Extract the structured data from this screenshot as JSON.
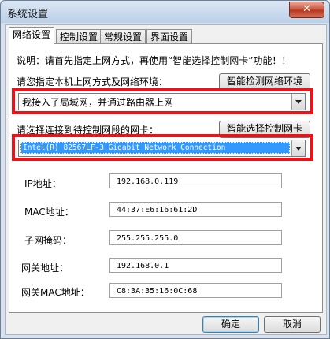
{
  "window": {
    "title": "系统设置",
    "close_label": "✕"
  },
  "tabs": [
    "网络设置",
    "控制设置",
    "常规设置",
    "界面设置"
  ],
  "notice": "说明：请首先指定上网方式，再使用“智能选择控制网卡”功能！！",
  "network_mode": {
    "label": "请您指定本机上网方式及网络环境：",
    "detect_button": "智能检测网络环境",
    "value": "我接入了局域网，并通过路由器上网"
  },
  "adapter": {
    "label": "请选择连接到待控制网段的网卡：",
    "select_button": "智能选择控制网卡",
    "value": "Intel(R) 82567LF-3 Gigabit Network Connection"
  },
  "fields": [
    {
      "label": "IP地址：",
      "value": "192.168.0.119"
    },
    {
      "label": "MAC地址：",
      "value": "44:37:E6:16:61:2D"
    },
    {
      "label": "子网掩码：",
      "value": "255.255.255.0"
    },
    {
      "label": "网关地址：",
      "value": "192.168.0.1"
    },
    {
      "label": "网关MAC地址：",
      "value": "C8:3A:35:16:0C:68"
    }
  ],
  "footer": {
    "ok": "确定",
    "cancel": "取消"
  },
  "colors": {
    "highlight_border": "#e8141a",
    "selection": "#3399ff"
  }
}
